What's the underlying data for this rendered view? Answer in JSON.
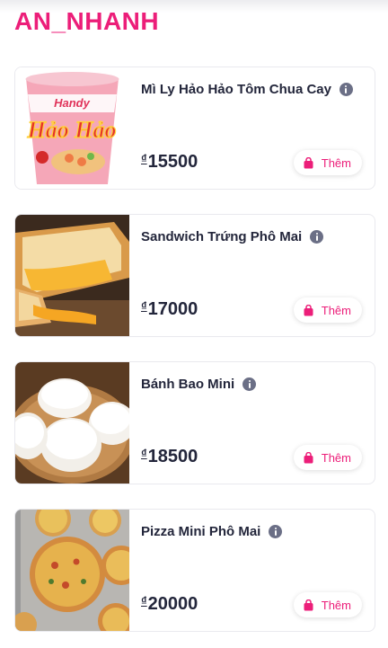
{
  "section": {
    "title": "AN_NHANH"
  },
  "accent_color": "#ec1e79",
  "currency_symbol": "₫",
  "add_label": "Thêm",
  "products": [
    {
      "name": "Mì Ly Hảo Hảo Tôm Chua Cay",
      "price": "15500",
      "image": "instant-noodle-cup"
    },
    {
      "name": "Sandwich Trứng Phô Mai",
      "price": "17000",
      "image": "cheese-sandwich"
    },
    {
      "name": "Bánh Bao Mini",
      "price": "18500",
      "image": "steamed-buns"
    },
    {
      "name": "Pizza Mini Phô Mai",
      "price": "20000",
      "image": "mini-pizzas"
    }
  ]
}
